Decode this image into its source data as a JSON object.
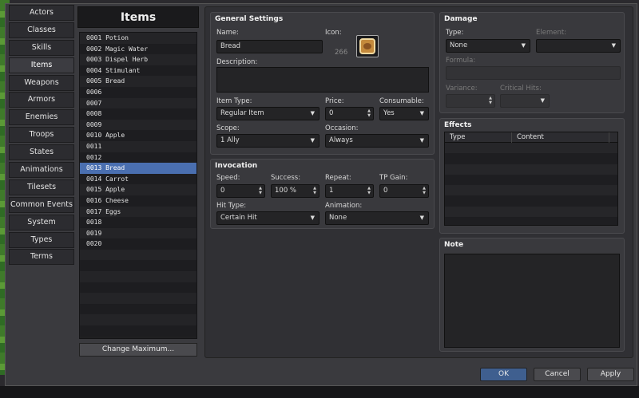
{
  "tabs": [
    "Actors",
    "Classes",
    "Skills",
    "Items",
    "Weapons",
    "Armors",
    "Enemies",
    "Troops",
    "States",
    "Animations",
    "Tilesets",
    "Common Events",
    "System",
    "Types",
    "Terms"
  ],
  "list": {
    "header": "Items",
    "rows": [
      "0001 Potion",
      "0002 Magic Water",
      "0003 Dispel Herb",
      "0004 Stimulant",
      "0005 Bread",
      "0006",
      "0007",
      "0008",
      "0009",
      "0010 Apple",
      "0011",
      "0012",
      "0013 Bread",
      "0014 Carrot",
      "0015 Apple",
      "0016 Cheese",
      "0017 Eggs",
      "0018",
      "0019",
      "0020",
      "",
      "",
      "",
      "",
      "",
      "",
      "",
      ""
    ],
    "selected_index": 12,
    "change_max_label": "Change Maximum..."
  },
  "general": {
    "title": "General Settings",
    "name_label": "Name:",
    "name_value": "Bread",
    "icon_label": "Icon:",
    "icon_number": "266",
    "icon_name": "bread-icon",
    "description_label": "Description:",
    "item_type_label": "Item Type:",
    "item_type_value": "Regular Item",
    "price_label": "Price:",
    "price_value": "0",
    "consumable_label": "Consumable:",
    "consumable_value": "Yes",
    "scope_label": "Scope:",
    "scope_value": "1 Ally",
    "occasion_label": "Occasion:",
    "occasion_value": "Always"
  },
  "invocation": {
    "title": "Invocation",
    "speed_label": "Speed:",
    "speed_value": "0",
    "success_label": "Success:",
    "success_value": "100 %",
    "repeat_label": "Repeat:",
    "repeat_value": "1",
    "tp_label": "TP Gain:",
    "tp_value": "0",
    "hit_type_label": "Hit Type:",
    "hit_type_value": "Certain Hit",
    "animation_label": "Animation:",
    "animation_value": "None"
  },
  "damage": {
    "title": "Damage",
    "type_label": "Type:",
    "type_value": "None",
    "element_label": "Element:",
    "formula_label": "Formula:",
    "variance_label": "Variance:",
    "critical_label": "Critical Hits:"
  },
  "effects": {
    "title": "Effects",
    "col_type": "Type",
    "col_content": "Content"
  },
  "note": {
    "title": "Note"
  },
  "buttons": {
    "ok": "OK",
    "cancel": "Cancel",
    "apply": "Apply"
  },
  "colors": {
    "selection": "#4a6fb0",
    "ok_button": "#3f5f8f",
    "background": "#2b2a2e"
  }
}
